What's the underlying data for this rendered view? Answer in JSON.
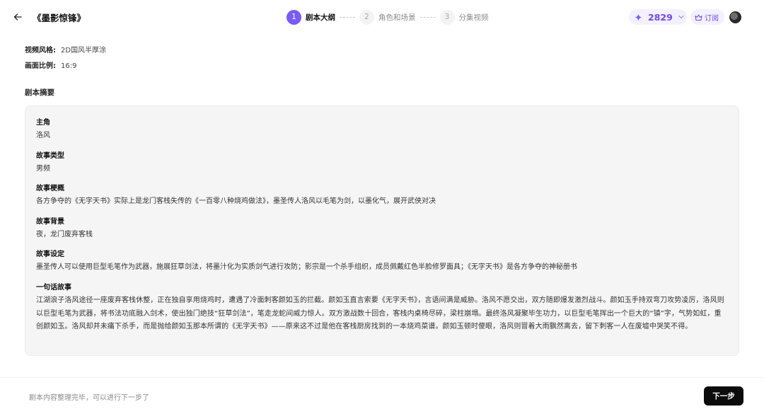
{
  "header": {
    "title": "《墨影惊锋》",
    "steps": [
      {
        "num": "1",
        "label": "剧本大纲"
      },
      {
        "num": "2",
        "label": "角色和场景"
      },
      {
        "num": "3",
        "label": "分集视频"
      }
    ],
    "credits": "2829",
    "subscribe_label": "订阅",
    "accent_color": "#7a5af8"
  },
  "meta": {
    "style_label": "视频风格:",
    "style_value": "2D国风半厚涂",
    "ratio_label": "画面比例:",
    "ratio_value": "16:9"
  },
  "summary": {
    "title": "剧本摘要",
    "fields": [
      {
        "label": "主角",
        "value": "洛风"
      },
      {
        "label": "故事类型",
        "value": "男频"
      },
      {
        "label": "故事梗概",
        "value": "各方争夺的《无字天书》实际上是龙门客栈失传的《一百零八种烧鸡做法》，墨圣传人洛风以毛笔为剑，以墨化气，展开武侠对决"
      },
      {
        "label": "故事背景",
        "value": "夜，龙门废弃客栈"
      },
      {
        "label": "故事设定",
        "value": "墨圣传人可以使用巨型毛笔作为武器，施展狂草剑法，将墨汁化为实质剑气进行攻防；影宗是一个杀手组织，成员佩戴红色半脸修罗面具；《无字天书》是各方争夺的神秘册书"
      },
      {
        "label": "一句话故事",
        "value": "江湖浪子洛风途径一座废弃客栈休整，正在独自享用烧鸡时，遭遇了冷面刺客颜如玉的拦截。颜如玉直言索要《无字天书》，言语间满是威胁。洛风不愿交出，双方随即爆发激烈战斗。颜如玉手持双弯刀攻势凌厉，洛风则以巨型毛笔为武器，将书法功底融入剑术，使出独门绝技“狂草剑法”，笔走龙蛇间威力惊人。双方激战数十回合，客栈内桌椅尽碎，梁柱崩塌。最终洛风凝聚毕生功力，以巨型毛笔挥出一个巨大的“镇”字，气势如虹，重创颜如玉。洛风却并未痛下杀手，而是抛给颜如玉那本所谓的《无字天书》——原来这不过是他在客栈厨房找到的一本烧鸡菜谱。颜如玉顿时傻眼，洛风则冒着大雨飘然离去，留下刺客一人在废墟中哭笑不得。"
      }
    ]
  },
  "footer": {
    "hint": "剧本内容整理完毕，可以进行下一步了",
    "next_label": "下一步"
  }
}
